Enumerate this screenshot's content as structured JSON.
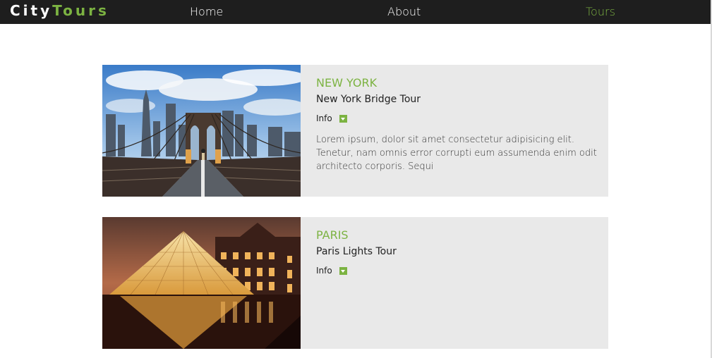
{
  "brand": {
    "part1": "City",
    "part2": "Tours"
  },
  "nav": {
    "home": "Home",
    "about": "About",
    "tours": "Tours"
  },
  "tours": [
    {
      "city": "NEW YORK",
      "name": "New York Bridge Tour",
      "info_label": "Info",
      "description": "Lorem ipsum, dolor sit amet consectetur adipisicing elit. Tenetur, nam omnis error corrupti eum assumenda enim odit architecto corporis. Sequi"
    },
    {
      "city": "PARIS",
      "name": "Paris Lights Tour",
      "info_label": "Info"
    }
  ],
  "colors": {
    "accent": "#7cb342",
    "nav_bg": "#1e1e1e",
    "card_bg": "#e9e9e9"
  }
}
